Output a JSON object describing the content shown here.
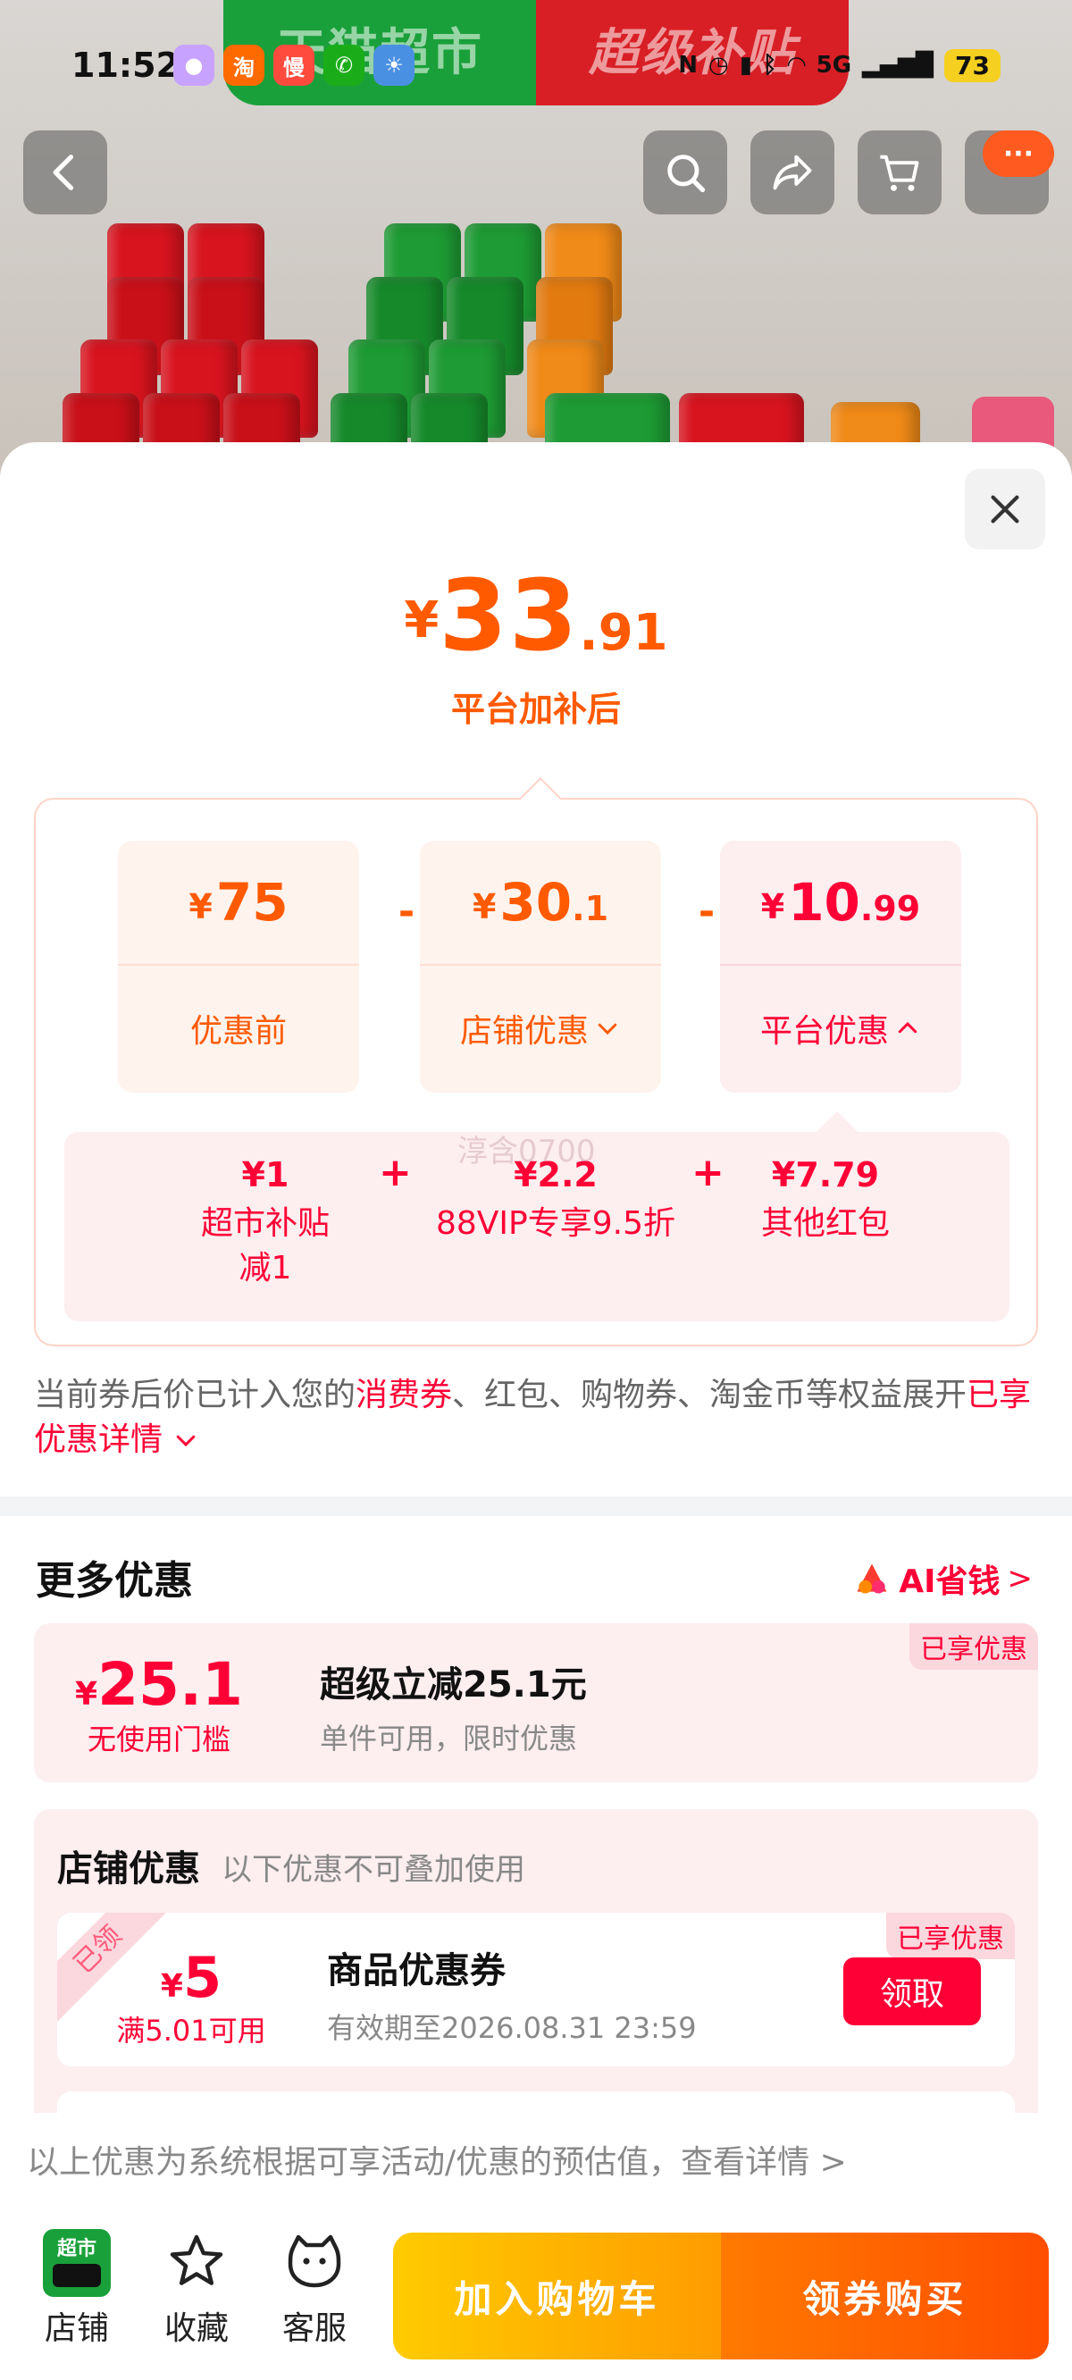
{
  "status_bar": {
    "time": "11:52",
    "battery": "73",
    "network": "5G",
    "apps": [
      {
        "icon": "bot-app-icon",
        "text": "",
        "color": "#c8a2ff"
      },
      {
        "icon": "taobao-icon",
        "text": "淘",
        "color": "#ff6a00"
      },
      {
        "icon": "slow-icon",
        "text": "慢",
        "color": "#ff4b3e"
      },
      {
        "icon": "wechat-icon",
        "text": "",
        "color": "#1aad19"
      },
      {
        "icon": "weather-icon",
        "text": "",
        "color": "#4a90e2"
      }
    ]
  },
  "banner": {
    "left": "天猫超市",
    "right": "超级补贴"
  },
  "top_nav": {
    "more": "···"
  },
  "sheet": {
    "price": {
      "currency": "¥",
      "integer": "33",
      "decimal": ".91",
      "subtitle": "平台加补后"
    },
    "breakdown": [
      {
        "currency": "¥",
        "integer": "75",
        "decimal": "",
        "label": "优惠前"
      },
      {
        "currency": "¥",
        "integer": "30",
        "decimal": ".1",
        "label": "店铺优惠"
      },
      {
        "currency": "¥",
        "integer": "10",
        "decimal": ".99",
        "label": "平台优惠"
      }
    ],
    "operators": [
      "-",
      "-",
      "+",
      "+"
    ],
    "platform_detail": [
      {
        "value": "¥1",
        "label_line1": "超市补贴",
        "label_line2": "减1"
      },
      {
        "value": "¥2.2",
        "label_line1": "88VIP专享9.5折",
        "label_line2": ""
      },
      {
        "value": "¥7.79",
        "label_line1": "其他红包",
        "label_line2": ""
      }
    ],
    "watermark": "淳含0700",
    "note": {
      "part1": "当前券后价已计入您的",
      "hl1": "消费券",
      "part2": "、红包、购物券、淘金币等权益展开",
      "hl2": "已享优惠详情"
    },
    "more_title": "更多优惠",
    "ai_link": "AI省钱",
    "ai_arrow": ">",
    "coupon1": {
      "badge": "已享优惠",
      "currency": "¥",
      "value": "25.1",
      "condition": "无使用门槛",
      "title": "超级立减25.1元",
      "desc": "单件可用，限时优惠"
    },
    "shop_section": {
      "title": "店铺优惠",
      "subtitle": "以下优惠不可叠加使用",
      "coupon": {
        "ribbon": "已领",
        "badge": "已享优惠",
        "currency": "¥",
        "value": "5",
        "condition": "满5.01可用",
        "title": "商品优惠券",
        "desc": "有效期至2026.08.31 23:59",
        "button": "领取"
      }
    },
    "disclaimer": "以上优惠为系统根据可享活动/优惠的预估值，查看详情 >"
  },
  "bottom_bar": {
    "shop_logo": "超市",
    "shop": "店铺",
    "favorite": "收藏",
    "service": "客服",
    "add_cart": "加入购物车",
    "buy": "领券购买"
  },
  "colors": {
    "accent_orange": "#ff5a00",
    "accent_red": "#ff0036",
    "green": "#1aa03a"
  }
}
